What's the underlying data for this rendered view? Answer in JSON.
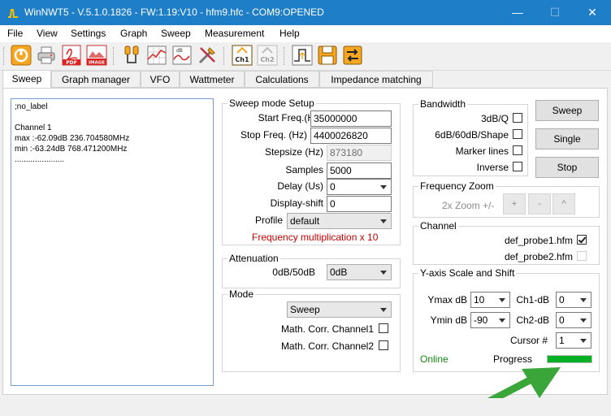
{
  "window": {
    "title": "WinNWT5 - V.5.1.0.1826 - FW:1.19:V10 - hfm9.hfc - COM9:OPENED",
    "minimize": "—",
    "maximize": "☐",
    "close": "✕"
  },
  "menu": [
    "File",
    "View",
    "Settings",
    "Graph",
    "Sweep",
    "Measurement",
    "Help"
  ],
  "toolbar": {
    "icons": [
      "power-icon",
      "printer-icon",
      "pdf-icon",
      "image-icon",
      "probe-icon",
      "grid-icon",
      "db-curve-icon",
      "tools-icon",
      "ch1-icon",
      "ch2-icon",
      "pulse-icon",
      "save-icon",
      "transfer-icon"
    ],
    "pdf_label": "PDF",
    "image_label": "IMAGE",
    "db_label": "dB",
    "ch1_label": "Ch1",
    "ch2_label": "Ch2"
  },
  "tabs": [
    "Sweep",
    "Graph manager",
    "VFO",
    "Wattmeter",
    "Calculations",
    "Impedance matching"
  ],
  "info": {
    "text": ";no_label\n\nChannel 1\nmax :-62.09dB 236.704580MHz\nmin :-63.24dB 768.471200MHz\n......................"
  },
  "sweep_mode": {
    "title": "Sweep mode Setup",
    "start_label": "Start Freq.(Hz)",
    "start_value": "35000000",
    "stop_label": "Stop Freq. (Hz)",
    "stop_value": "4400026820",
    "stepsize_label": "Stepsize (Hz)",
    "stepsize_value": "873180",
    "samples_label": "Samples",
    "samples_value": "5000",
    "delay_label": "Delay (Us)",
    "delay_value": "0",
    "shift_label": "Display-shift",
    "shift_value": "0",
    "profile_label": "Profile",
    "profile_value": "default",
    "freq_mult": "Frequency multiplication x 10"
  },
  "attenuation": {
    "title": "Attenuation",
    "label": "0dB/50dB",
    "value": "0dB"
  },
  "mode": {
    "title": "Mode",
    "value": "Sweep",
    "corr1": "Math. Corr. Channel1",
    "corr2": "Math. Corr. Channel2"
  },
  "bandwidth": {
    "title": "Bandwidth",
    "item1": "3dB/Q",
    "item2": "6dB/60dB/Shape",
    "item3": "Marker lines",
    "item4": "Inverse"
  },
  "buttons": {
    "sweep": "Sweep",
    "single": "Single",
    "stop": "Stop"
  },
  "freq_zoom": {
    "title": "Frequency Zoom",
    "label": "2x Zoom +/-",
    "plus": "+",
    "minus": "-",
    "caret": "^"
  },
  "channel": {
    "title": "Channel",
    "probe1": "def_probe1.hfm",
    "probe2": "def_probe2.hfm"
  },
  "yaxis": {
    "title": "Y-axis Scale and Shift",
    "ymax_label": "Ymax dB",
    "ymax_value": "10",
    "ymin_label": "Ymin dB",
    "ymin_value": "-90",
    "ch1_label": "Ch1-dB",
    "ch1_value": "0",
    "ch2_label": "Ch2-dB",
    "ch2_value": "0",
    "cursor_label": "Cursor #",
    "cursor_value": "1"
  },
  "status": {
    "online": "Online",
    "progress_label": "Progress",
    "progress_value": 1.0,
    "online_color": "#138a13",
    "progress_color": "#06b025",
    "accent_color": "#1f7ec8",
    "freq_mult_color": "#cc0000"
  }
}
